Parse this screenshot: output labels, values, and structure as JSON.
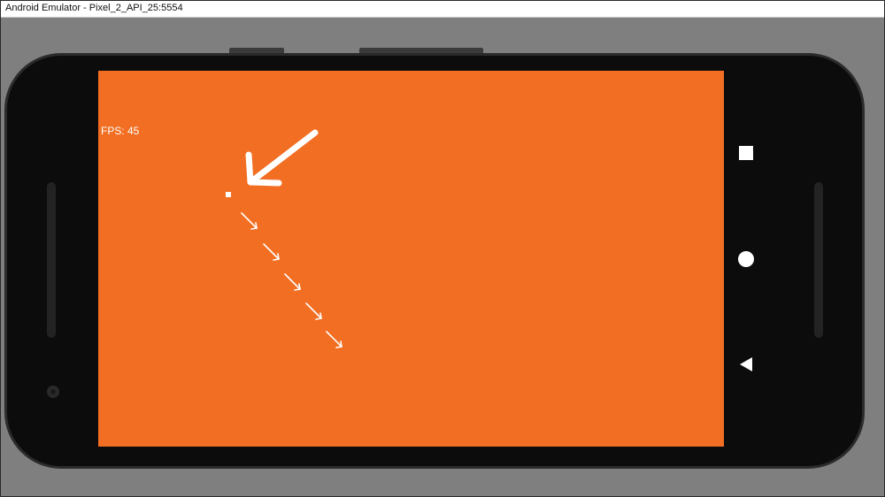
{
  "window": {
    "title": "Android Emulator - Pixel_2_API_25:5554"
  },
  "screen": {
    "background_color": "#f26e22",
    "fps_label": "FPS: 45"
  },
  "nav_bar": {
    "buttons": [
      {
        "name": "overview",
        "icon": "square-icon"
      },
      {
        "name": "home",
        "icon": "circle-icon"
      },
      {
        "name": "back",
        "icon": "triangle-left-icon"
      }
    ]
  },
  "colors": {
    "workspace": "#7f7f7f",
    "phone_body": "#111111",
    "annotation": "#ffffff"
  }
}
